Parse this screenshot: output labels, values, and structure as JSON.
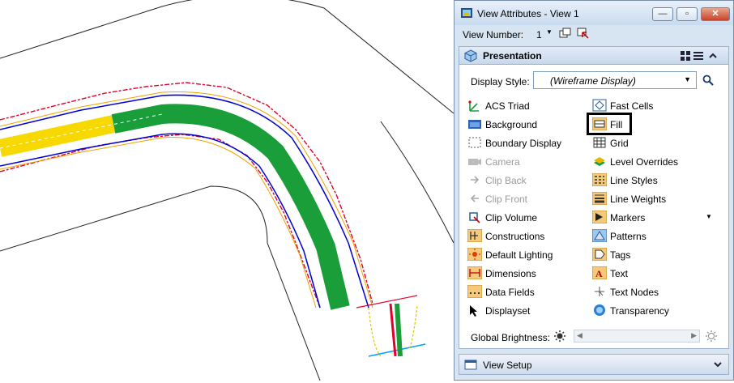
{
  "dialog": {
    "title": "View Attributes - View 1",
    "window_buttons": {
      "minimize": "—",
      "maximize": "▫",
      "close": "✕"
    },
    "view_number_label": "View Number:",
    "view_number_value": "1"
  },
  "presentation": {
    "title": "Presentation",
    "display_style_label": "Display Style:",
    "display_style_value": "(Wireframe Display)",
    "left_items": [
      {
        "label": "ACS Triad",
        "icon": "acs-triad-icon",
        "enabled": true
      },
      {
        "label": "Background",
        "icon": "background-icon",
        "enabled": true
      },
      {
        "label": "Boundary Display",
        "icon": "boundary-display-icon",
        "enabled": true
      },
      {
        "label": "Camera",
        "icon": "camera-icon",
        "enabled": false
      },
      {
        "label": "Clip Back",
        "icon": "clip-back-icon",
        "enabled": false
      },
      {
        "label": "Clip Front",
        "icon": "clip-front-icon",
        "enabled": false
      },
      {
        "label": "Clip Volume",
        "icon": "clip-volume-icon",
        "enabled": true
      },
      {
        "label": "Constructions",
        "icon": "constructions-icon",
        "enabled": true
      },
      {
        "label": "Default Lighting",
        "icon": "default-lighting-icon",
        "enabled": true
      },
      {
        "label": "Dimensions",
        "icon": "dimensions-icon",
        "enabled": true
      },
      {
        "label": "Data Fields",
        "icon": "data-fields-icon",
        "enabled": true
      },
      {
        "label": "Displayset",
        "icon": "displayset-icon",
        "enabled": true
      }
    ],
    "right_items": [
      {
        "label": "Fast Cells",
        "icon": "fast-cells-icon",
        "enabled": true
      },
      {
        "label": "Fill",
        "icon": "fill-icon",
        "enabled": true
      },
      {
        "label": "Grid",
        "icon": "grid-icon",
        "enabled": true
      },
      {
        "label": "Level Overrides",
        "icon": "level-overrides-icon",
        "enabled": true
      },
      {
        "label": "Line Styles",
        "icon": "line-styles-icon",
        "enabled": true
      },
      {
        "label": "Line Weights",
        "icon": "line-weights-icon",
        "enabled": true
      },
      {
        "label": "Markers",
        "icon": "markers-icon",
        "enabled": true
      },
      {
        "label": "Patterns",
        "icon": "patterns-icon",
        "enabled": true
      },
      {
        "label": "Tags",
        "icon": "tags-icon",
        "enabled": true
      },
      {
        "label": "Text",
        "icon": "text-icon",
        "enabled": true
      },
      {
        "label": "Text Nodes",
        "icon": "text-nodes-icon",
        "enabled": true
      },
      {
        "label": "Transparency",
        "icon": "transparency-icon",
        "enabled": true
      }
    ],
    "global_brightness_label": "Global Brightness:"
  },
  "view_setup": {
    "title": "View Setup"
  },
  "colors": {
    "accent": "#d7e4f2",
    "alignment_green": "#1a9e3a",
    "yellow": "#f7d800",
    "red": "#e0002a",
    "blue": "#0000d0"
  }
}
